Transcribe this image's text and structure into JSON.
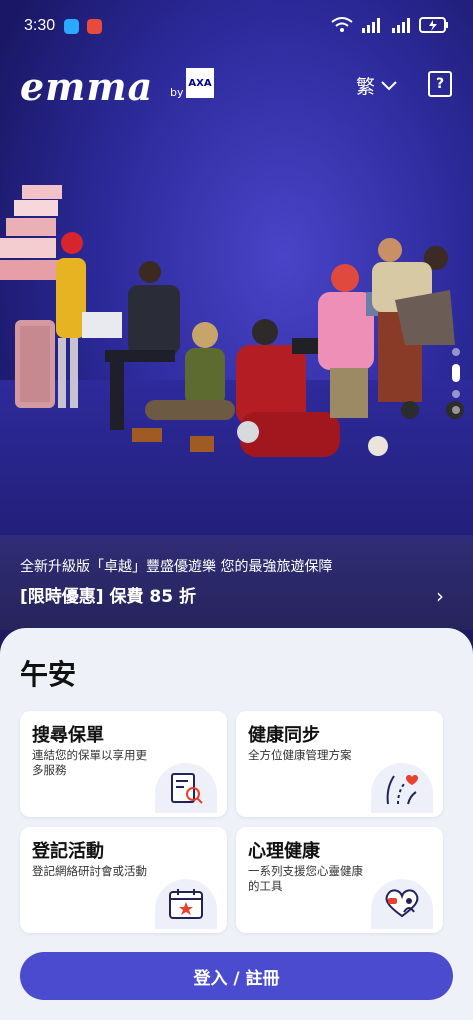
{
  "status_bar": {
    "time": "3:30"
  },
  "header": {
    "logo_text": "emma",
    "logo_by": "by",
    "axa_text": "AXA",
    "language": "繁"
  },
  "carousel": {
    "slide_count": 4,
    "active_slide": 2
  },
  "promo": {
    "line1": "全新升級版「卓越」豐盛優遊樂 您的最強旅遊保障",
    "line2": "[限時優惠] 保費 85 折"
  },
  "greeting": "午安",
  "cards": [
    {
      "title": "搜尋保單",
      "desc": "連結您的保單以享用更多服務",
      "icon": "policy-search-icon"
    },
    {
      "title": "健康同步",
      "desc": "全方位健康管理方案",
      "icon": "health-sync-icon"
    },
    {
      "title": "登記活動",
      "desc": "登記網絡研討會或活動",
      "icon": "calendar-event-icon"
    },
    {
      "title": "心理健康",
      "desc": "一系列支援您心靈健康的工具",
      "icon": "mental-health-icon"
    }
  ],
  "login_button": "登入 / 註冊",
  "colors": {
    "primary": "#4b4bcf",
    "hero_bg": "#2c2a9a",
    "panel_bg": "#eef1f8",
    "axa_blue": "#00008f",
    "accent_red": "#e8412e"
  }
}
